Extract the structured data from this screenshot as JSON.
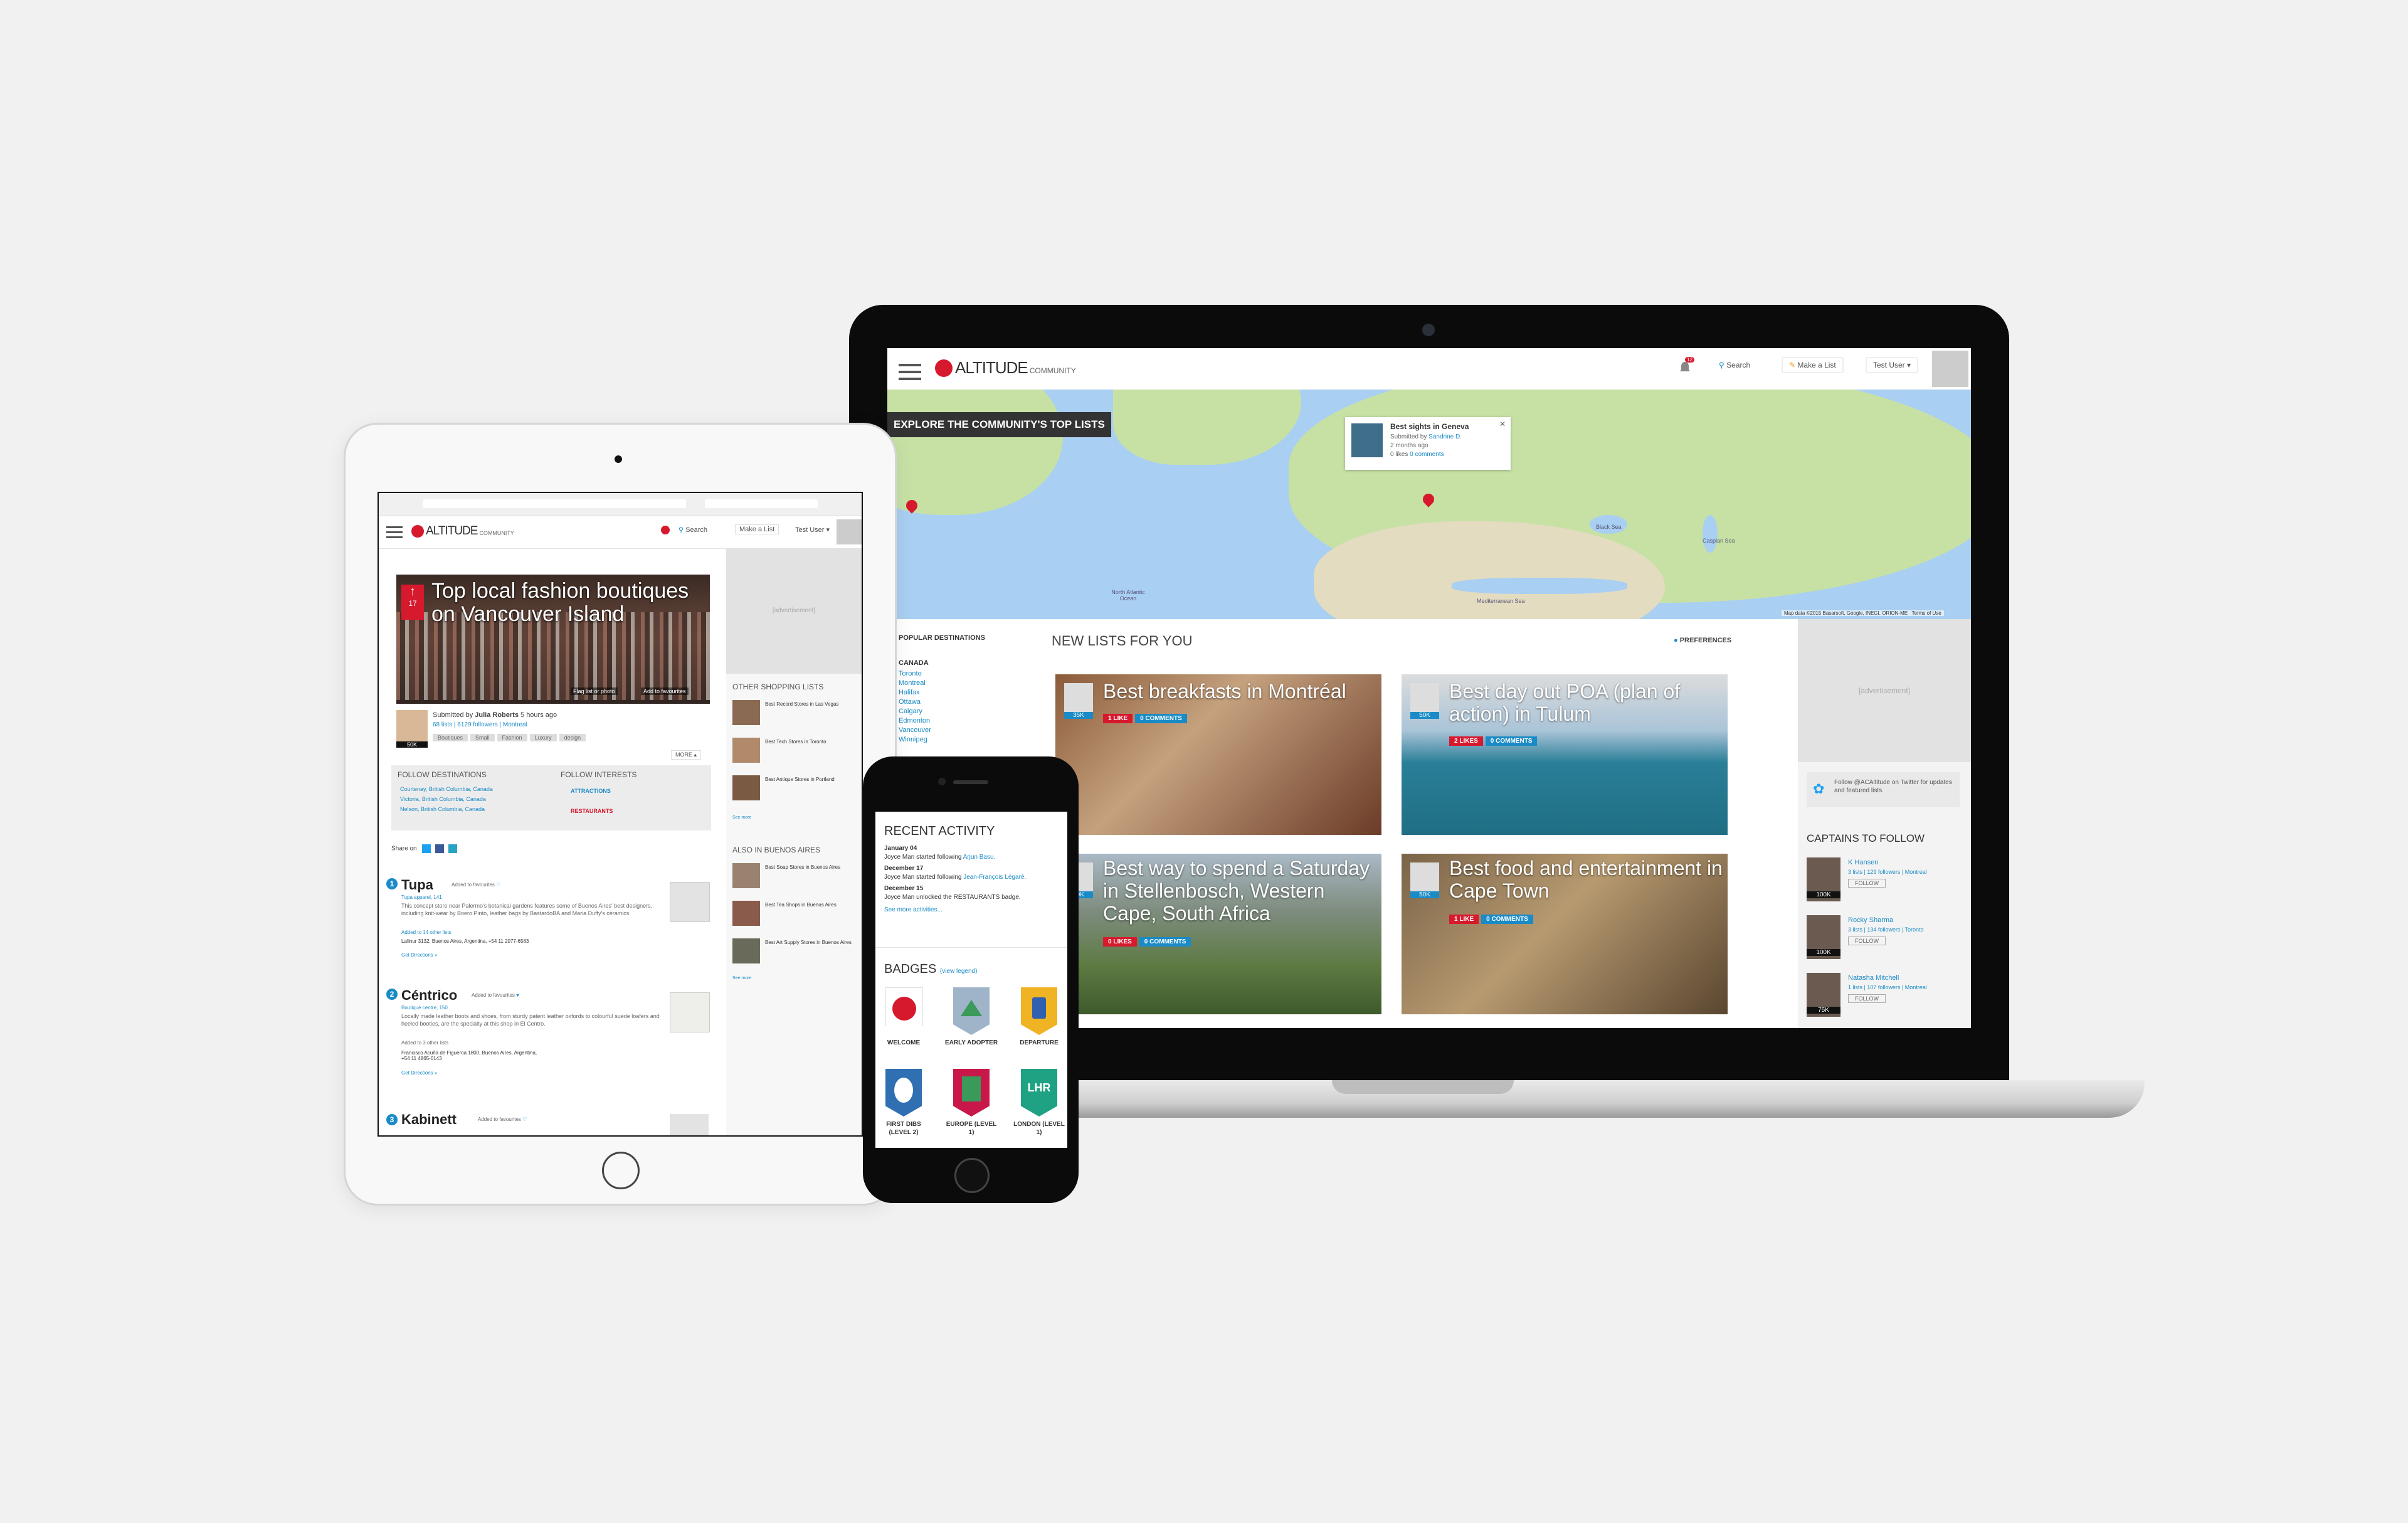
{
  "laptop": {
    "nav": {
      "logo_text": "ALTITUDE",
      "logo_sub": "COMMUNITY",
      "notif_count": "12",
      "search_label": "Search",
      "make_list_label": "Make a List",
      "user_label": "Test User"
    },
    "map": {
      "banner": "EXPLORE THE COMMUNITY'S TOP LISTS",
      "popup_title": "Best sights in Geneva",
      "popup_submitted": "Submitted by",
      "popup_author": "Sandrine D.",
      "popup_time": "2 months ago",
      "popup_likes": "0 likes",
      "popup_comments": "0 comments",
      "ocean_label": "North Atlantic Ocean",
      "sea_black": "Black Sea",
      "sea_caspian": "Caspian Sea",
      "sea_med": "Mediterranean Sea",
      "footer": "Map data ©2015 Basarsoft, Google, INEGI, ORION-ME",
      "terms": "Terms of Use"
    },
    "sidebar": {
      "heading": "POPULAR DESTINATIONS",
      "country": "CANADA",
      "cities": [
        "Toronto",
        "Montreal",
        "Halifax",
        "Ottawa",
        "Calgary",
        "Edmonton",
        "Vancouver",
        "Winnipeg"
      ]
    },
    "main": {
      "heading": "NEW LISTS FOR YOU",
      "preferences": "PREFERENCES",
      "cards": [
        {
          "title": "Best breakfasts in Montréal",
          "count": "35K",
          "likes": "1 LIKE",
          "comments": "0 COMMENTS"
        },
        {
          "title": "Best day out POA (plan of action) in Tulum",
          "count": "50K",
          "likes": "2 LIKES",
          "comments": "0 COMMENTS"
        },
        {
          "title": "Best way to spend a Saturday in Stellenbosch, Western Cape, South Africa",
          "count": "50K",
          "likes": "0 LIKES",
          "comments": "0 COMMENTS"
        },
        {
          "title": "Best food and entertainment in Cape Town",
          "count": "50K",
          "likes": "1 LIKE",
          "comments": "0 COMMENTS"
        }
      ]
    },
    "right": {
      "ad": "[advertisement]",
      "twitter_text": "Follow @ACAltitude on Twitter for updates and featured lists.",
      "captains_heading": "CAPTAINS TO FOLLOW",
      "captains": [
        {
          "name": "K Hansen",
          "meta": "3 lists | 129 followers | Montreal",
          "badge": "100K",
          "follow": "FOLLOW"
        },
        {
          "name": "Rocky Sharma",
          "meta": "3 lists | 134 followers | Toronto",
          "badge": "100K",
          "follow": "FOLLOW"
        },
        {
          "name": "Natasha Mitchell",
          "meta": "1 lists | 107 followers | Montreal",
          "badge": "75K",
          "follow": "FOLLOW"
        }
      ]
    }
  },
  "tablet": {
    "nav": {
      "logo_text": "ALTITUDE",
      "logo_sub": "COMMUNITY",
      "search_label": "Search",
      "make_list_label": "Make a List",
      "user_label": "Test User"
    },
    "hero": {
      "title": "Top local fashion boutiques on Vancouver Island",
      "rank": "17",
      "flag": "Flag list or photo",
      "fav": "Add to favourites"
    },
    "author": {
      "submitted": "Submitted by",
      "name": "Julia Roberts",
      "time": "5 hours ago",
      "stats": "68 lists | 6129 followers | Montreal",
      "badge": "50K",
      "tags": [
        "Boutiques",
        "Small",
        "Fashion",
        "Luxury",
        "design"
      ],
      "more": "MORE"
    },
    "follow": {
      "dest_heading": "FOLLOW DESTINATIONS",
      "destinations": [
        "Courtenay, British Columbia, Canada",
        "Victoria, British Columbia, Canada",
        "Nelson, British Columbia, Canada"
      ],
      "int_heading": "FOLLOW INTERESTS",
      "interests": [
        "ATTRACTIONS",
        "RESTAURANTS"
      ]
    },
    "share": "Share on",
    "items": [
      {
        "n": "1",
        "title": "Tupa",
        "fav": "Added to favourites",
        "sub": "Tupa apparel, 141",
        "desc": "This concept store near Palermo's botanical gardens features some of Buenos Aires' best designers, including knit-wear by Boero Pinto, leather bags by BastardoBA and Maria Duffy's ceramics.",
        "added": "Added to 14 other lists",
        "addr": "Lafinur 3132, Buenos Aires, Argentina, +54 11 2077-6583",
        "dir": "Get Directions »"
      },
      {
        "n": "2",
        "title": "Céntrico",
        "fav": "Added to favourites",
        "sub": "Boutique centre, 150",
        "desc": "Locally made leather boots and shoes, from sturdy patent leather oxfords to colourful suede loafers and heeled booties, are the specialty at this shop in El Centro.",
        "added": "Added to 3 other lists",
        "addr": "Francisco Acuña de Figueroa 1800, Buenos Aires, Argentina, +54 11 4865-0143",
        "dir": "Get Directions »"
      },
      {
        "n": "3",
        "title": "Kabinett",
        "fav": "Added to favourites"
      }
    ],
    "side": {
      "ad": "[advertisement]",
      "other_heading": "OTHER SHOPPING LISTS",
      "other": [
        "Best Record Stores in Las Vegas",
        "Best Tech Stores in Toronto",
        "Best Antique Stores in Portland"
      ],
      "also_heading": "ALSO IN BUENOS AIRES",
      "also": [
        "Best Soap Stores in Buenos Aires",
        "Best Tea Shops in Buenos Aires",
        "Best Art Supply Stores in Buenos Aires"
      ],
      "see_more": "See more"
    }
  },
  "phone": {
    "activity_heading": "RECENT ACTIVITY",
    "entries": [
      {
        "date": "January 04",
        "text": "Joyce Man started following",
        "link": "Arjun Basu."
      },
      {
        "date": "December 17",
        "text": "Joyce Man started following",
        "link": "Jean-François Légaré."
      },
      {
        "date": "December 15",
        "text": "Joyce Man unlocked the RESTAURANTS badge.",
        "link": ""
      }
    ],
    "see_more": "See more activities...",
    "badges_heading": "BADGES",
    "legend": "(view legend)",
    "badges": [
      {
        "label": "WELCOME",
        "color": "#ffffff"
      },
      {
        "label": "EARLY ADOPTER",
        "color": "#9fb4c9"
      },
      {
        "label": "DEPARTURE",
        "color": "#f0b323"
      },
      {
        "label": "FIRST DIBS (LEVEL 2)",
        "color": "#2f6fb2"
      },
      {
        "label": "EUROPE (LEVEL 1)",
        "color": "#c8184a"
      },
      {
        "label": "LONDON (LEVEL 1)",
        "color": "#1fa184"
      }
    ],
    "london_code": "LHR"
  }
}
